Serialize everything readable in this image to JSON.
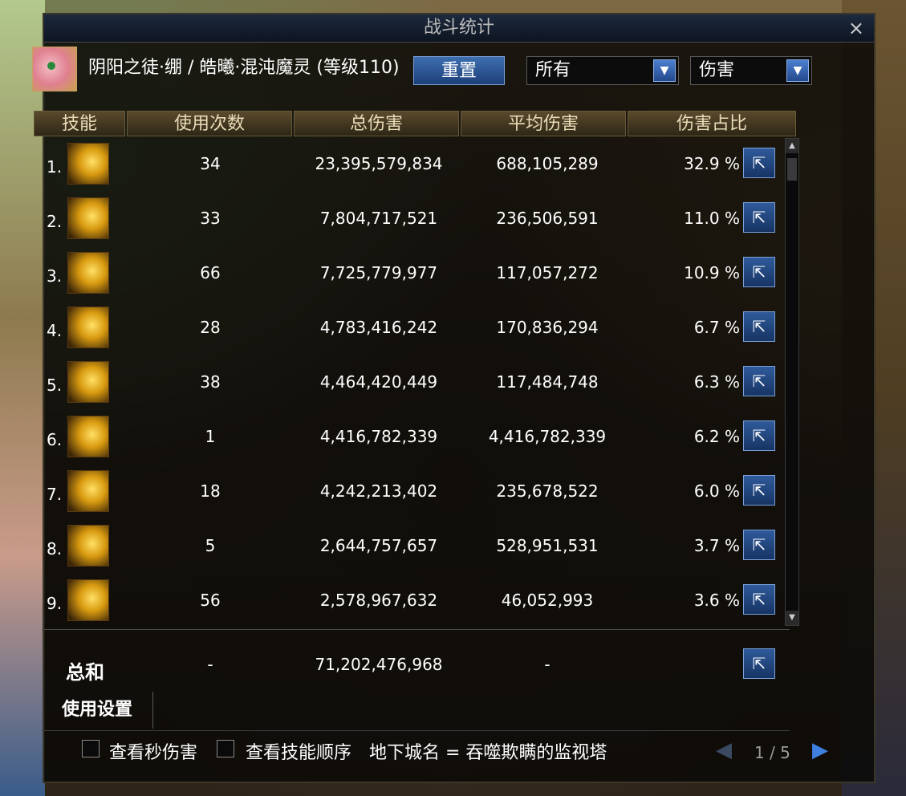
{
  "window": {
    "title": "战斗统计",
    "close": "×"
  },
  "header": {
    "character_name": "阴阳之徒·绷 / 皓曦·混沌魔灵 (等级110)",
    "reset_label": "重置",
    "filter_select": "所有",
    "metric_select": "伤害",
    "dropdown_arrow": "▼"
  },
  "columns": [
    "技能",
    "使用次数",
    "总伤害",
    "平均伤害",
    "伤害占比"
  ],
  "rows": [
    {
      "index": "1.",
      "uses": "34",
      "total": "23,395,579,834",
      "avg": "688,105,289",
      "pct": "32.9 %"
    },
    {
      "index": "2.",
      "uses": "33",
      "total": "7,804,717,521",
      "avg": "236,506,591",
      "pct": "11.0 %"
    },
    {
      "index": "3.",
      "uses": "66",
      "total": "7,725,779,977",
      "avg": "117,057,272",
      "pct": "10.9 %"
    },
    {
      "index": "4.",
      "uses": "28",
      "total": "4,783,416,242",
      "avg": "170,836,294",
      "pct": "6.7 %"
    },
    {
      "index": "5.",
      "uses": "38",
      "total": "4,464,420,449",
      "avg": "117,484,748",
      "pct": "6.3 %"
    },
    {
      "index": "6.",
      "uses": "1",
      "total": "4,416,782,339",
      "avg": "4,416,782,339",
      "pct": "6.2 %"
    },
    {
      "index": "7.",
      "uses": "18",
      "total": "4,242,213,402",
      "avg": "235,678,522",
      "pct": "6.0 %"
    },
    {
      "index": "8.",
      "uses": "5",
      "total": "2,644,757,657",
      "avg": "528,951,531",
      "pct": "3.7 %"
    },
    {
      "index": "9.",
      "uses": "56",
      "total": "2,578,967,632",
      "avg": "46,052,993",
      "pct": "3.6 %"
    }
  ],
  "total": {
    "label": "总和",
    "uses": "-",
    "total": "71,202,476,968",
    "avg": "-"
  },
  "settings_tab": "使用设置",
  "footer": {
    "cb_per_second": "查看秒伤害",
    "cb_skill_order": "查看技能顺序",
    "dungeon": "地下城名 = 吞噬欺瞒的监视塔",
    "page": "1 / 5",
    "prev": "◀",
    "next": "▶"
  },
  "share_icon": "share-icon",
  "share_glyph": "⇱"
}
